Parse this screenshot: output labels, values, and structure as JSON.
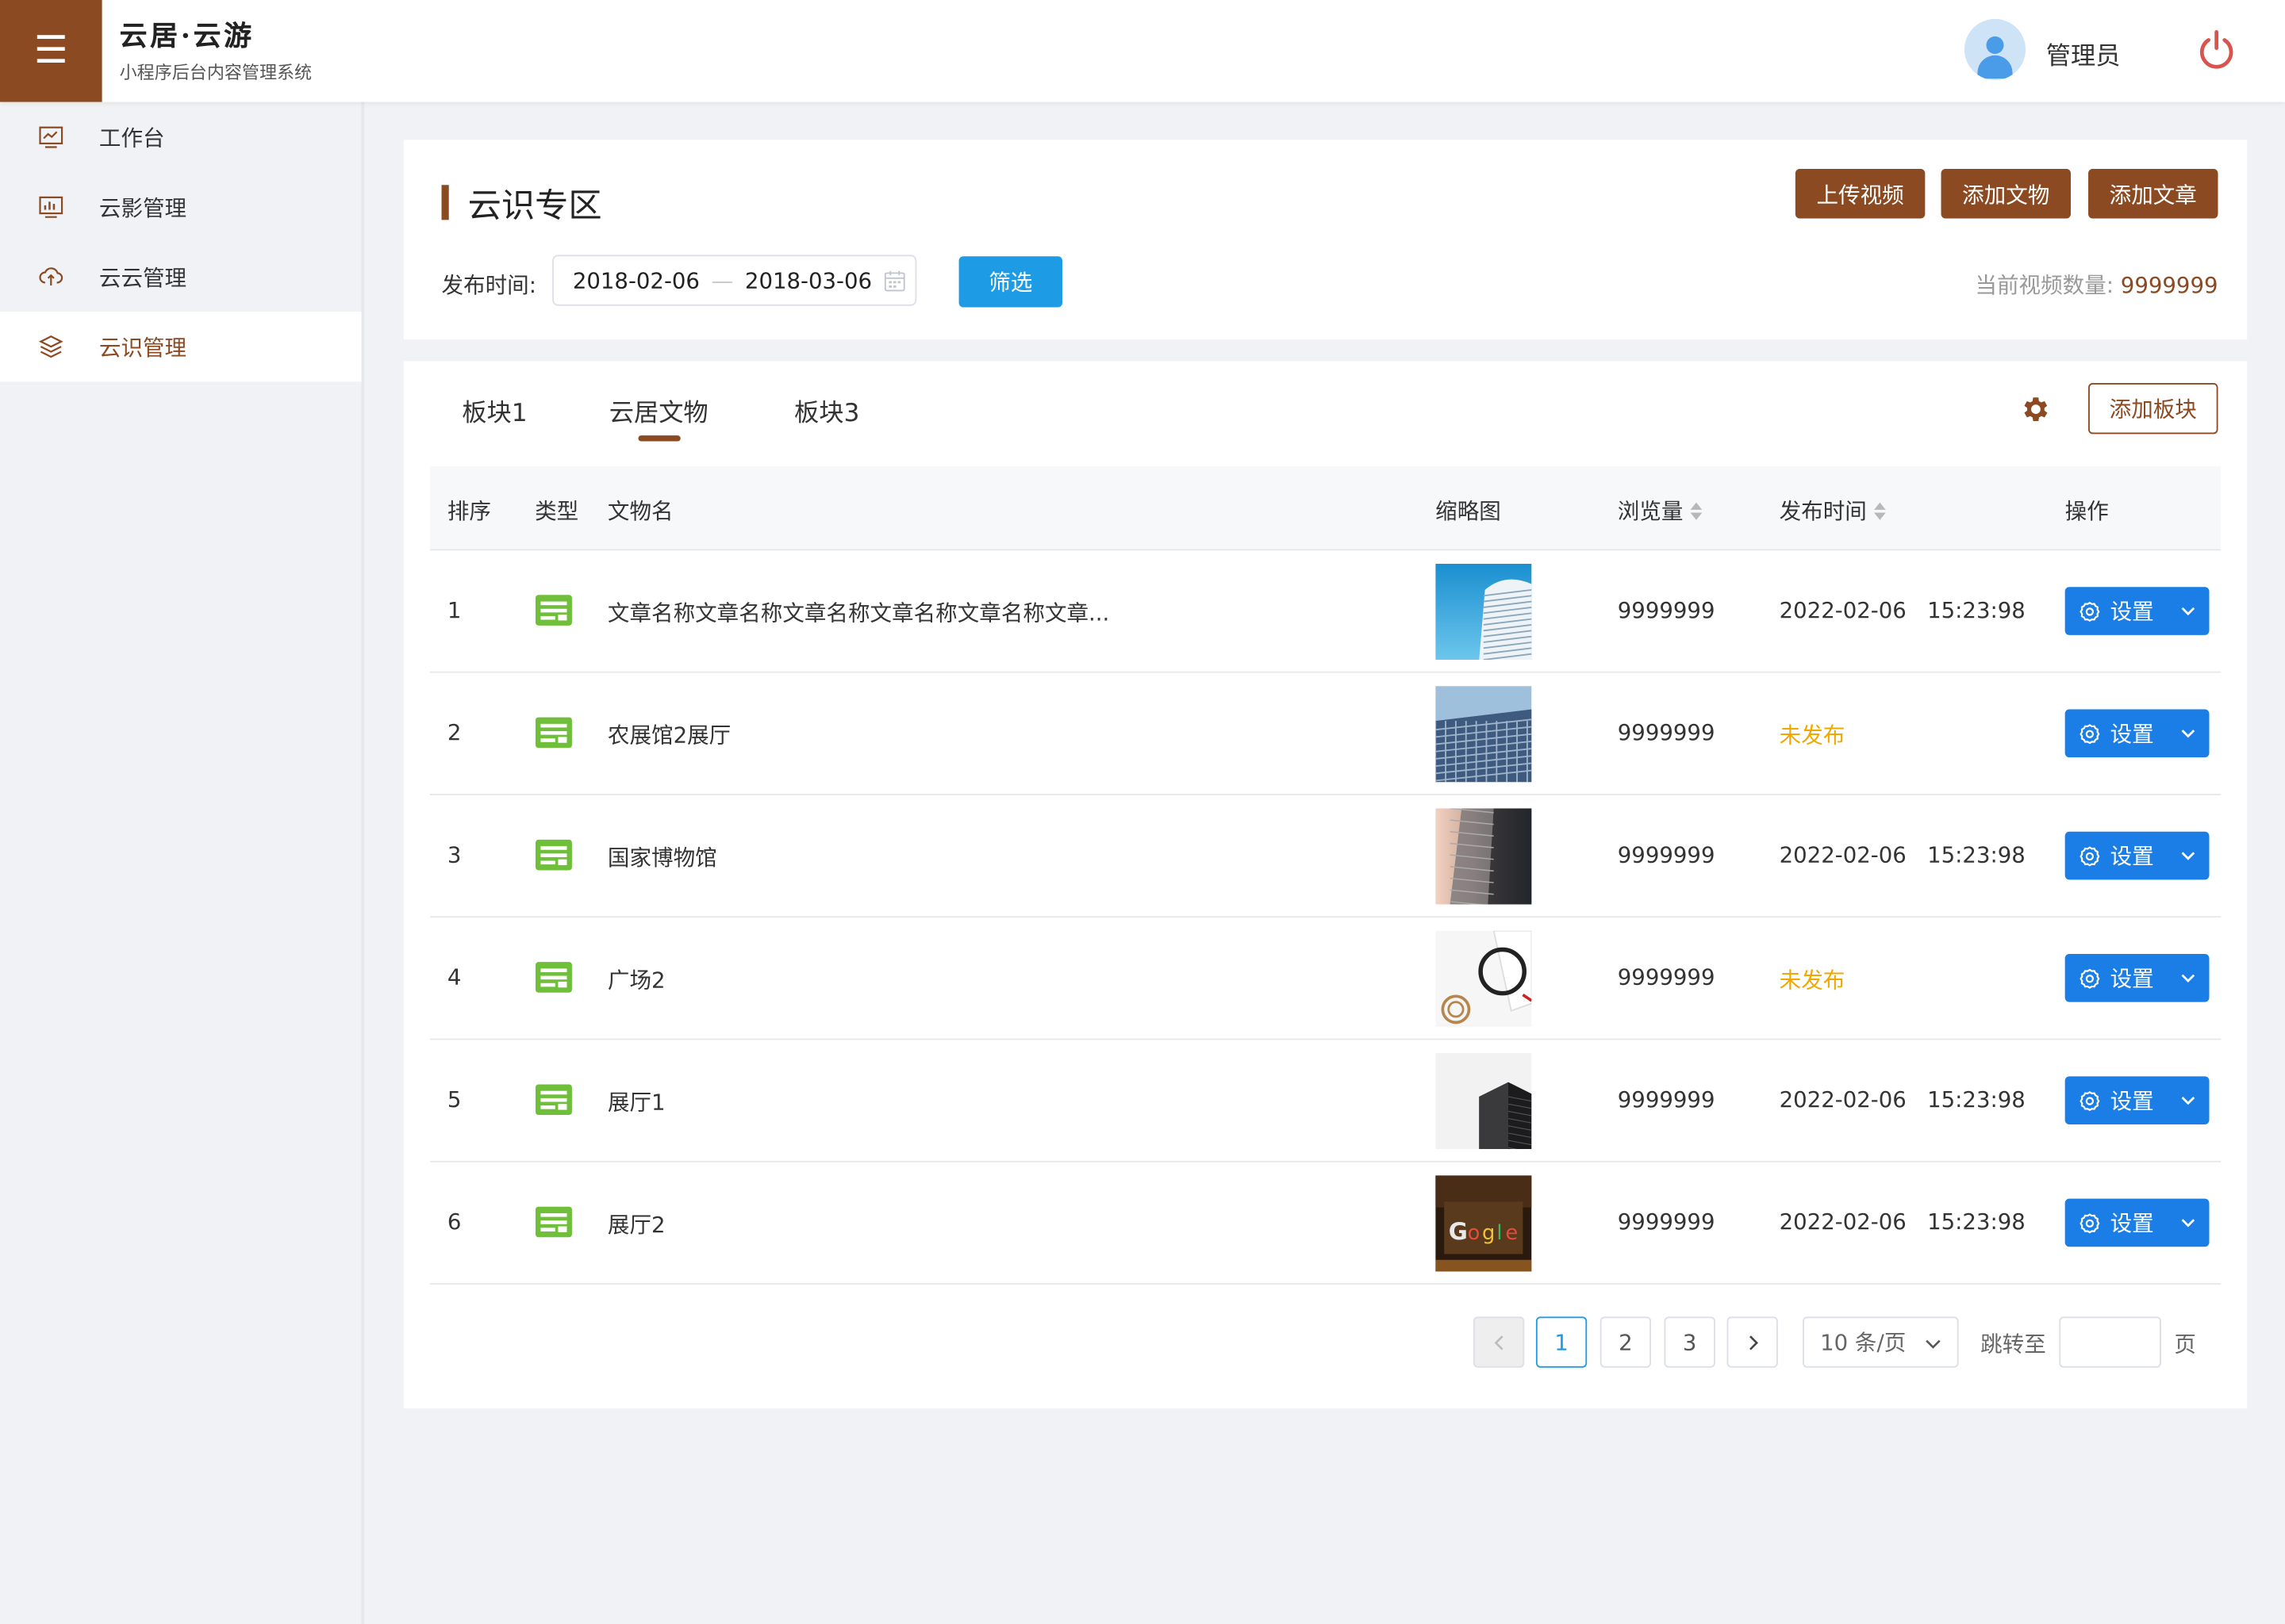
{
  "header": {
    "brand_title": "云居·云游",
    "brand_subtitle": "小程序后台内容管理系统",
    "username": "管理员"
  },
  "sidebar": {
    "items": [
      {
        "label": "工作台",
        "icon": "chart-line-icon"
      },
      {
        "label": "云影管理",
        "icon": "monitor-chart-icon"
      },
      {
        "label": "云云管理",
        "icon": "cloud-upload-icon"
      },
      {
        "label": "云识管理",
        "icon": "layers-icon",
        "active": true
      }
    ]
  },
  "section": {
    "title": "云识专区",
    "buttons": [
      "上传视频",
      "添加文物",
      "添加文章"
    ],
    "filter_label": "发布时间:",
    "date_start": "2018-02-06",
    "date_sep": "—",
    "date_end": "2018-03-06",
    "filter_button": "筛选",
    "count_label": "当前视频数量: ",
    "count_value": "9999999"
  },
  "tabs": {
    "items": [
      "板块1",
      "云居文物",
      "板块3"
    ],
    "active_index": 1,
    "add_button": "添加板块"
  },
  "table": {
    "headers": [
      "排序",
      "类型",
      "文物名",
      "缩略图",
      "浏览量",
      "发布时间",
      "操作"
    ],
    "rows": [
      {
        "order": "1",
        "name": "文章名称文章名称文章名称文章名称文章名称文章...",
        "views": "9999999",
        "date": "2022-02-06",
        "time": "15:23:98",
        "published": true,
        "action": "设置"
      },
      {
        "order": "2",
        "name": "农展馆2展厅",
        "views": "9999999",
        "status": "未发布",
        "published": false,
        "action": "设置"
      },
      {
        "order": "3",
        "name": "国家博物馆",
        "views": "9999999",
        "date": "2022-02-06",
        "time": "15:23:98",
        "published": true,
        "action": "设置"
      },
      {
        "order": "4",
        "name": "广场2",
        "views": "9999999",
        "status": "未发布",
        "published": false,
        "action": "设置"
      },
      {
        "order": "5",
        "name": "展厅1",
        "views": "9999999",
        "date": "2022-02-06",
        "time": "15:23:98",
        "published": true,
        "action": "设置"
      },
      {
        "order": "6",
        "name": "展厅2",
        "views": "9999999",
        "date": "2022-02-06",
        "time": "15:23:98",
        "published": true,
        "action": "设置"
      }
    ]
  },
  "pagination": {
    "pages": [
      "1",
      "2",
      "3"
    ],
    "current": "1",
    "page_size": "10 条/页",
    "jump_label": "跳转至",
    "jump_value": "",
    "page_suffix": "页"
  },
  "colors": {
    "brand": "#8b4a22",
    "primary_blue": "#1a7ee6",
    "filter_blue": "#1d9ce5",
    "unpublished": "#f0a800",
    "type_icon_green": "#6fbf3b",
    "power_red": "#d9534f"
  }
}
